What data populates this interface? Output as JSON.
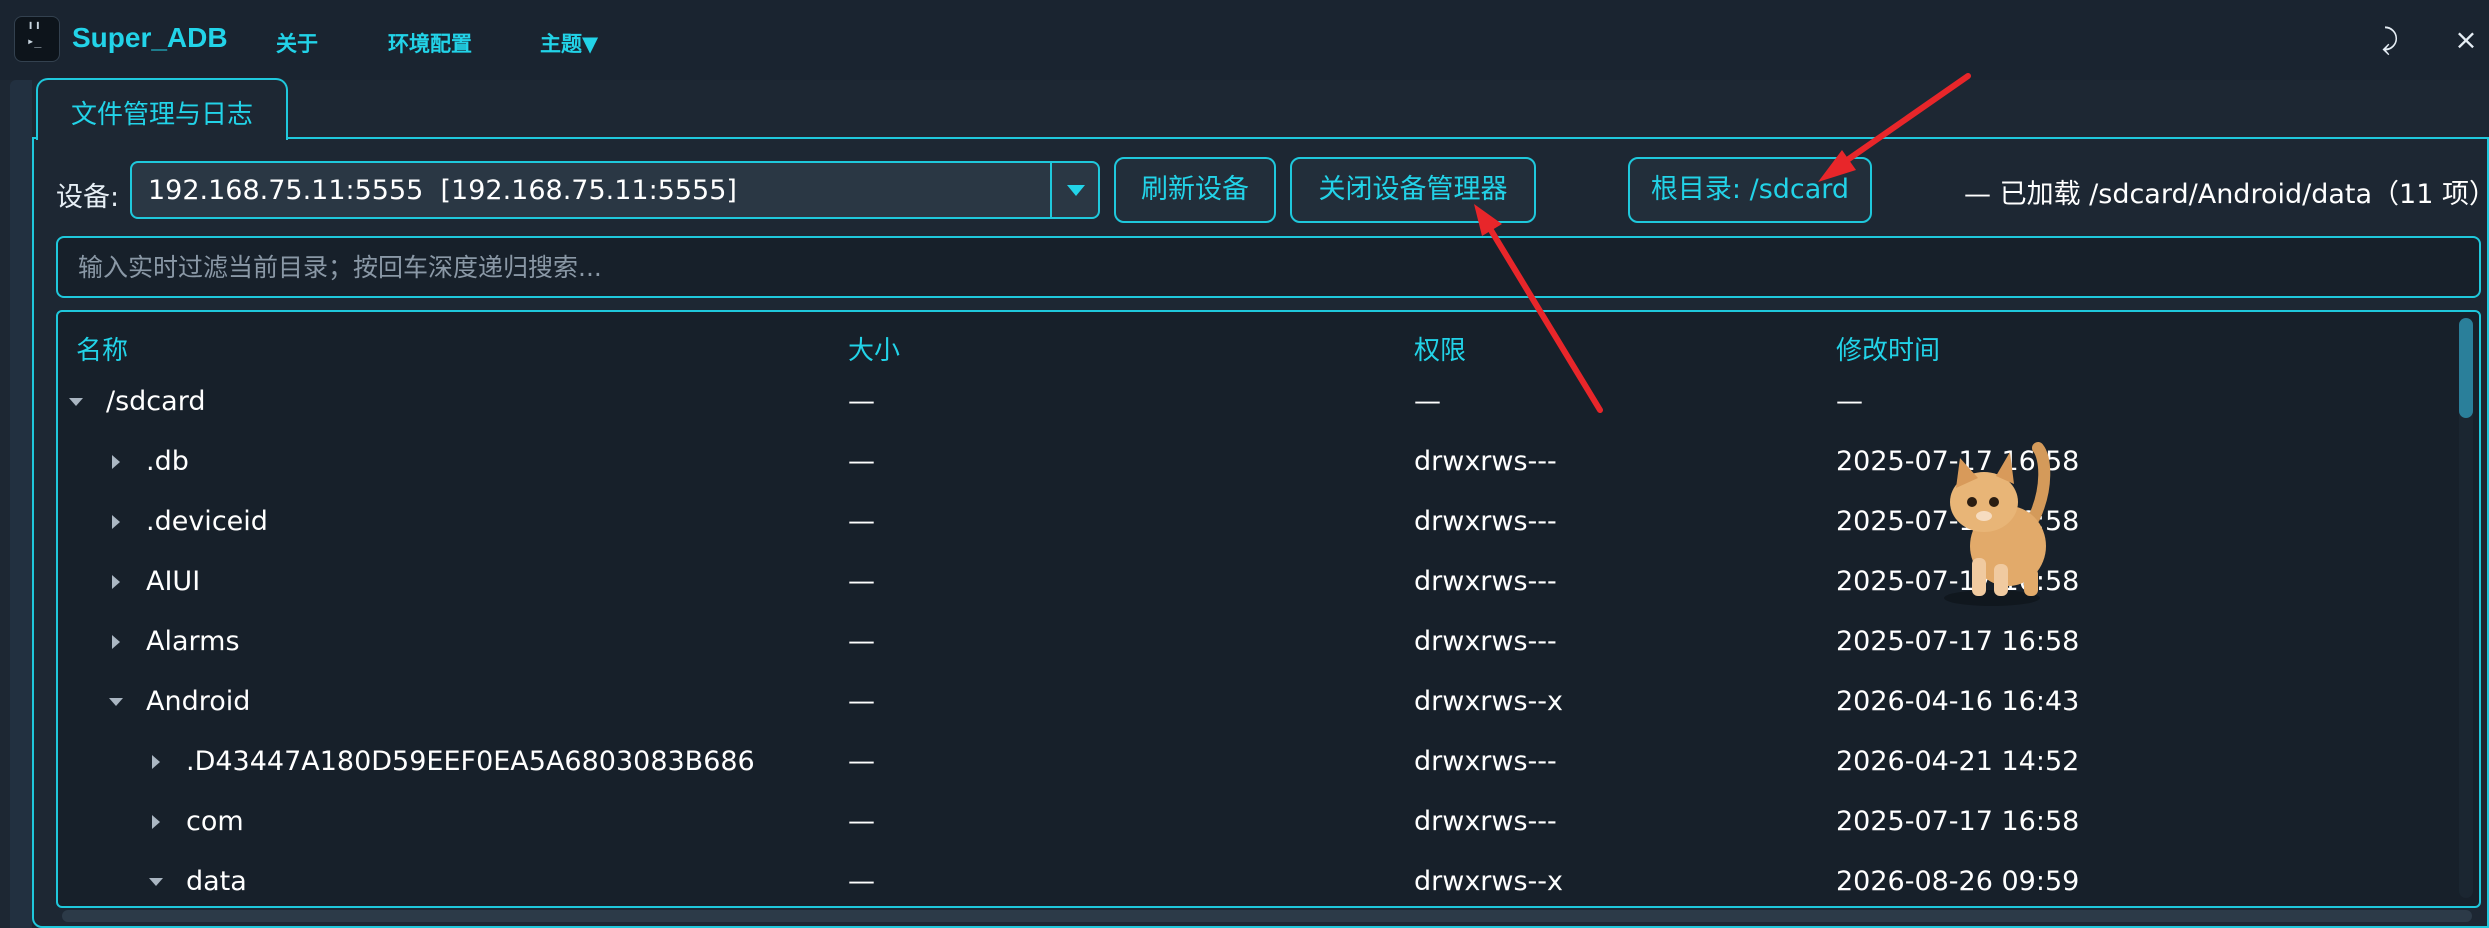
{
  "app": {
    "title": "Super_ADB"
  },
  "menu": [
    {
      "label": "关于"
    },
    {
      "label": "环境配置"
    },
    {
      "label": "主题▼"
    }
  ],
  "window_controls": {
    "minimize": "⤸",
    "close": "×"
  },
  "tabs": [
    {
      "label": "文件管理与日志"
    }
  ],
  "device": {
    "label": "设备:",
    "selected": "192.168.75.11:5555  [192.168.75.11:5555]"
  },
  "buttons": {
    "refresh": "刷新设备",
    "close_manager": "关闭设备管理器",
    "root_dir": "根目录: /sdcard"
  },
  "loaded_info": "—  已加载 /sdcard/Android/data（11 项）",
  "search": {
    "placeholder": "输入实时过滤当前目录；按回车深度递归搜索..."
  },
  "table": {
    "columns": [
      "名称",
      "大小",
      "权限",
      "修改时间"
    ],
    "rows": [
      {
        "name": "/sdcard",
        "size": "—",
        "perm": "—",
        "mtime": "—",
        "depth": 0,
        "expanded": true
      },
      {
        "name": ".db",
        "size": "—",
        "perm": "drwxrws---",
        "mtime": "2025-07-17 16:58",
        "depth": 1,
        "expanded": false
      },
      {
        "name": ".deviceid",
        "size": "—",
        "perm": "drwxrws---",
        "mtime": "2025-07-17 16:58",
        "depth": 1,
        "expanded": false
      },
      {
        "name": "AIUI",
        "size": "—",
        "perm": "drwxrws---",
        "mtime": "2025-07-17 16:58",
        "depth": 1,
        "expanded": false
      },
      {
        "name": "Alarms",
        "size": "—",
        "perm": "drwxrws---",
        "mtime": "2025-07-17 16:58",
        "depth": 1,
        "expanded": false
      },
      {
        "name": "Android",
        "size": "—",
        "perm": "drwxrws--x",
        "mtime": "2026-04-16 16:43",
        "depth": 1,
        "expanded": true
      },
      {
        "name": ".D43447A180D59EEF0EA5A6803083B686",
        "size": "—",
        "perm": "drwxrws---",
        "mtime": "2026-04-21 14:52",
        "depth": 2,
        "expanded": false
      },
      {
        "name": "com",
        "size": "—",
        "perm": "drwxrws---",
        "mtime": "2025-07-17 16:58",
        "depth": 2,
        "expanded": false
      },
      {
        "name": "data",
        "size": "—",
        "perm": "drwxrws--x",
        "mtime": "2026-08-26 09:59",
        "depth": 2,
        "expanded": true
      }
    ]
  },
  "colors": {
    "accent": "#22d3e8",
    "border": "#1fc8dc",
    "background": "#1d2733",
    "annotation": "#e8262a"
  }
}
